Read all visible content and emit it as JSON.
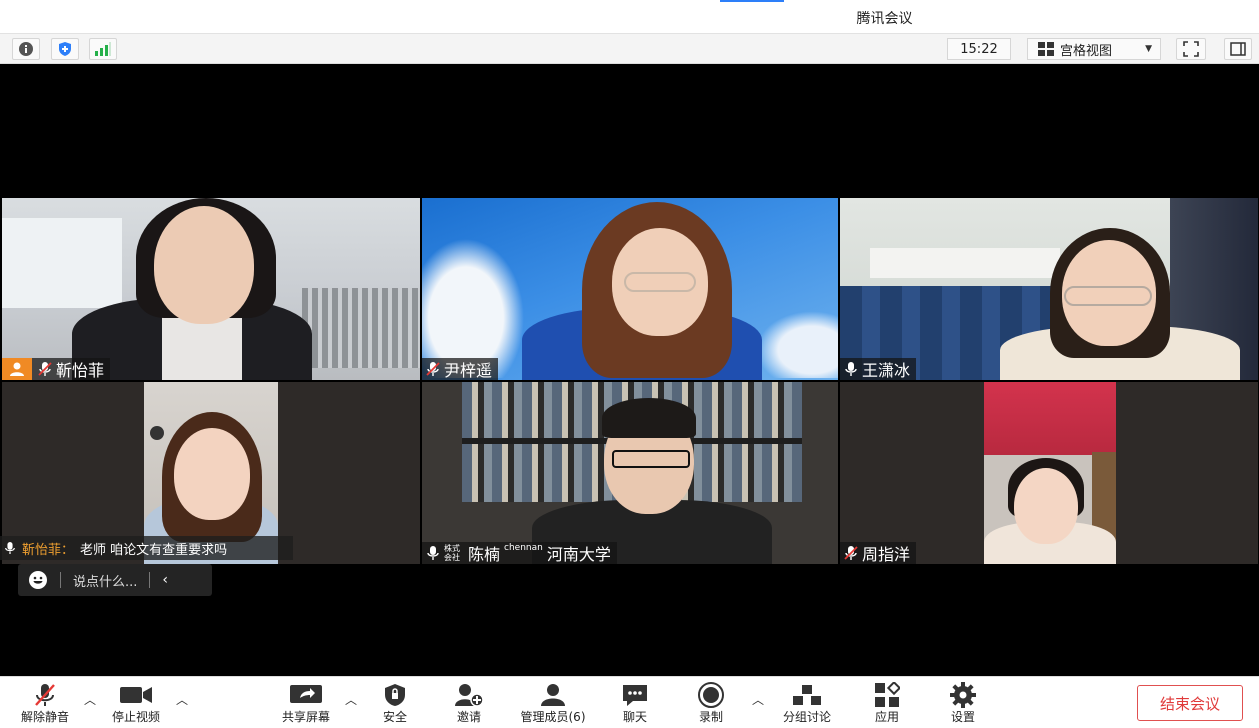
{
  "window": {
    "title": "腾讯会议"
  },
  "infobar": {
    "info_icon": "info-icon",
    "security_icon": "shield-icon",
    "signal_icon": "signal-bars-icon",
    "clock": "15:22",
    "view_mode": "宫格视图",
    "colors": {
      "signal": "#25b04a",
      "shield": "#2d7ff9"
    }
  },
  "participants": [
    {
      "name": "靳怡菲",
      "host": true,
      "muted": true
    },
    {
      "name": "尹梓遥",
      "host": false,
      "muted": true
    },
    {
      "name": "王潇冰",
      "host": false,
      "muted": false
    },
    {
      "name": "",
      "host": false,
      "muted": false
    },
    {
      "name": "陈楠",
      "prefix": "株式会社",
      "suffix": "chennan",
      "org": "河南大学",
      "host": false,
      "muted": false
    },
    {
      "name": "周指洋",
      "host": false,
      "muted": true
    }
  ],
  "chat": {
    "sender": "靳怡菲：",
    "message": "老师 咱论文有查重要求吗",
    "input_placeholder": "说点什么..."
  },
  "toolbar": {
    "unmute": "解除静音",
    "stop_video": "停止视频",
    "share_screen": "共享屏幕",
    "security": "安全",
    "invite": "邀请",
    "manage_members": "管理成员(6)",
    "chat": "聊天",
    "record": "录制",
    "breakout": "分组讨论",
    "apps": "应用",
    "settings": "设置",
    "end_meeting": "结束会议",
    "colors": {
      "end": "#e03a3a"
    }
  }
}
